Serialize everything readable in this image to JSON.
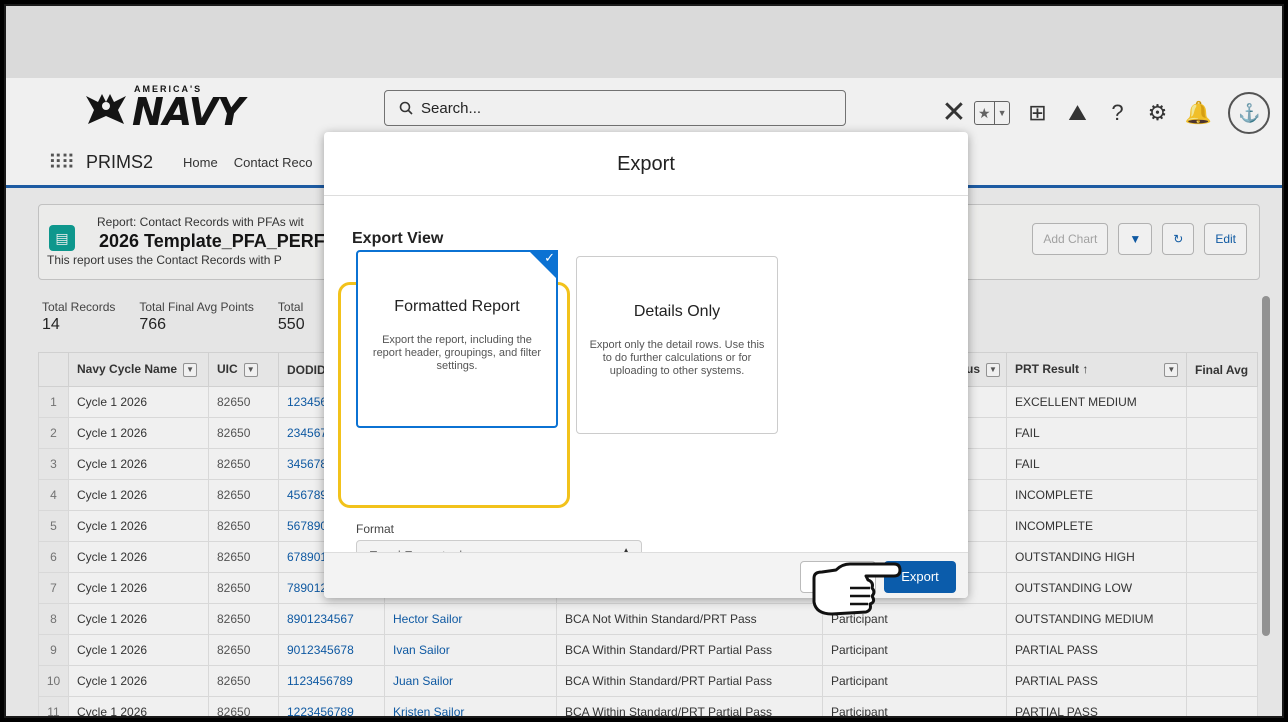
{
  "header": {
    "logo_super": "AMERICA'S",
    "logo_text": "NAVY",
    "search_placeholder": "Search...",
    "close_glyph": "✕"
  },
  "nav": {
    "app_name": "PRIMS2",
    "links": [
      "Home",
      "Contact Reco"
    ]
  },
  "report": {
    "subtitle": "Report: Contact Records with PFAs wit",
    "title": "2026 Template_PFA_PERF",
    "description": "This report uses the Contact Records with P",
    "add_chart": "Add Chart",
    "edit": "Edit"
  },
  "totals": [
    {
      "label": "Total Records",
      "value": "14"
    },
    {
      "label": "Total Final Avg Points",
      "value": "766"
    },
    {
      "label": "Total",
      "value": "550"
    }
  ],
  "table": {
    "headers": [
      "Navy Cycle Name",
      "UIC",
      "DODID",
      "",
      "",
      "us",
      "PRT Result ↑",
      "Final Avg"
    ],
    "rows": [
      {
        "n": "1",
        "cycle": "Cycle 1 2026",
        "uic": "82650",
        "dodid": "123456",
        "name": "",
        "cat": "",
        "role": "",
        "prt": "EXCELLENT MEDIUM"
      },
      {
        "n": "2",
        "cycle": "Cycle 1 2026",
        "uic": "82650",
        "dodid": "234567",
        "name": "",
        "cat": "",
        "role": "",
        "prt": "FAIL"
      },
      {
        "n": "3",
        "cycle": "Cycle 1 2026",
        "uic": "82650",
        "dodid": "345678",
        "name": "",
        "cat": "",
        "role": "",
        "prt": "FAIL"
      },
      {
        "n": "4",
        "cycle": "Cycle 1 2026",
        "uic": "82650",
        "dodid": "456789",
        "name": "",
        "cat": "",
        "role": "",
        "prt": "INCOMPLETE"
      },
      {
        "n": "5",
        "cycle": "Cycle 1 2026",
        "uic": "82650",
        "dodid": "567890",
        "name": "",
        "cat": "",
        "role": "",
        "prt": "INCOMPLETE"
      },
      {
        "n": "6",
        "cycle": "Cycle 1 2026",
        "uic": "82650",
        "dodid": "678901",
        "name": "",
        "cat": "",
        "role": "",
        "prt": "OUTSTANDING HIGH"
      },
      {
        "n": "7",
        "cycle": "Cycle 1 2026",
        "uic": "82650",
        "dodid": "789012",
        "name": "",
        "cat": "",
        "role": "",
        "prt": "OUTSTANDING LOW"
      },
      {
        "n": "8",
        "cycle": "Cycle 1 2026",
        "uic": "82650",
        "dodid": "8901234567",
        "name": "Hector Sailor",
        "cat": "BCA Not Within Standard/PRT Pass",
        "role": "Participant",
        "prt": "OUTSTANDING MEDIUM"
      },
      {
        "n": "9",
        "cycle": "Cycle 1 2026",
        "uic": "82650",
        "dodid": "9012345678",
        "name": "Ivan Sailor",
        "cat": "BCA Within Standard/PRT Partial Pass",
        "role": "Participant",
        "prt": "PARTIAL PASS"
      },
      {
        "n": "10",
        "cycle": "Cycle 1 2026",
        "uic": "82650",
        "dodid": "1123456789",
        "name": "Juan Sailor",
        "cat": "BCA Within Standard/PRT Partial Pass",
        "role": "Participant",
        "prt": "PARTIAL PASS"
      },
      {
        "n": "11",
        "cycle": "Cycle 1 2026",
        "uic": "82650",
        "dodid": "1223456789",
        "name": "Kristen Sailor",
        "cat": "BCA Within Standard/PRT Partial Pass",
        "role": "Participant",
        "prt": "PARTIAL PASS"
      }
    ]
  },
  "modal": {
    "title": "Export",
    "export_view_label": "Export View",
    "options": [
      {
        "title": "Formatted Report",
        "desc": "Export the report, including the report header, groupings, and filter settings.",
        "selected": true
      },
      {
        "title": "Details Only",
        "desc": "Export only the detail rows. Use this to do further calculations or for uploading to other systems.",
        "selected": false
      }
    ],
    "format_label": "Format",
    "format_value": "Excel Format .xlsx",
    "cancel_label": "Cancel",
    "export_label": "Export"
  },
  "colors": {
    "brand": "#0b5cab",
    "highlight": "#f2c21b",
    "selected": "#0b72d3"
  }
}
